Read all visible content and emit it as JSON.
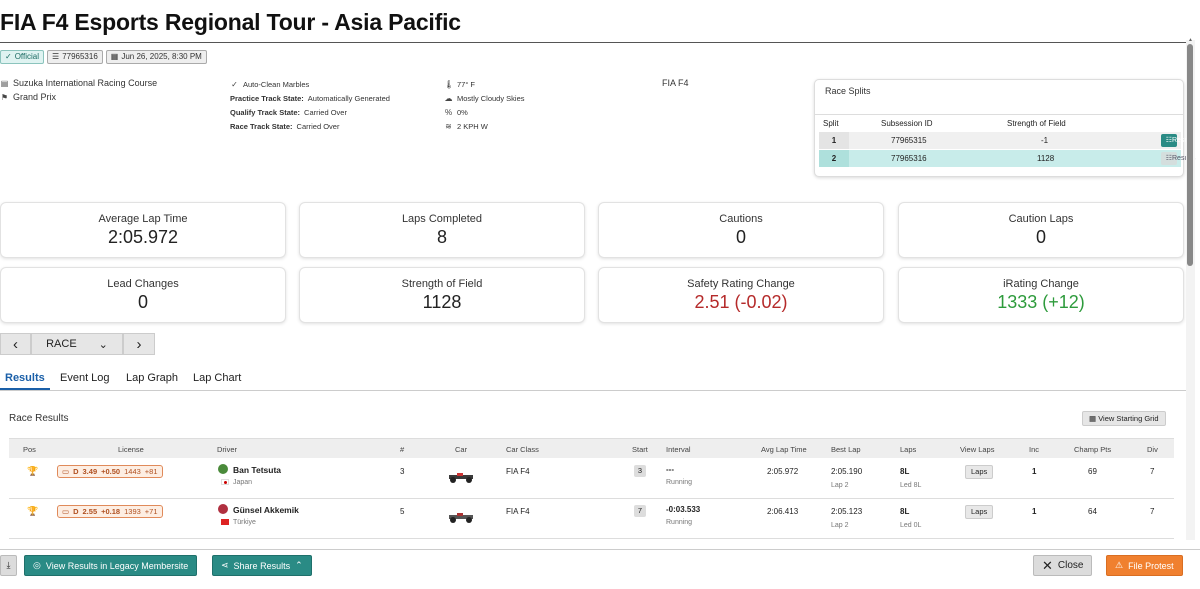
{
  "header": {
    "title": "FIA F4 Esports Regional Tour - Asia Pacific"
  },
  "badges": {
    "official": "Official",
    "subsession": "77965316",
    "date": "Jun 26, 2025, 8:30 PM"
  },
  "track": {
    "name": "Suzuka International Racing Course",
    "config": "Grand Prix"
  },
  "conditions": {
    "marbles": "Auto-Clean Marbles",
    "practice_label": "Practice Track State:",
    "practice_value": "Automatically Generated",
    "qualify_label": "Qualify Track State:",
    "qualify_value": "Carried Over",
    "race_label": "Race Track State:",
    "race_value": "Carried Over"
  },
  "weather": {
    "temp": "77° F",
    "sky": "Mostly Cloudy Skies",
    "rain": "0%",
    "wind": "2 KPH W"
  },
  "series_class": "FIA F4",
  "splits": {
    "title": "Race Splits",
    "headers": {
      "split": "Split",
      "subsession": "Subsession ID",
      "sof": "Strength of Field"
    },
    "rows": [
      {
        "split": "1",
        "subsession": "77965315",
        "sof": "-1",
        "button": "Results"
      },
      {
        "split": "2",
        "subsession": "77965316",
        "sof": "1128",
        "button": "Results"
      }
    ]
  },
  "stats": [
    {
      "label": "Average Lap Time",
      "value": "2:05.972"
    },
    {
      "label": "Laps Completed",
      "value": "8"
    },
    {
      "label": "Cautions",
      "value": "0"
    },
    {
      "label": "Caution Laps",
      "value": "0"
    },
    {
      "label": "Lead Changes",
      "value": "0"
    },
    {
      "label": "Strength of Field",
      "value": "1128"
    },
    {
      "label": "Safety Rating Change",
      "value": "2.51 (-0.02)"
    },
    {
      "label": "iRating Change",
      "value": "1333 (+12)"
    }
  ],
  "colors": {
    "accent": "#2a8b85",
    "negative": "#b52a2a",
    "positive": "#2e9b3c",
    "orange": "#f0802f",
    "tab_active": "#1a5fa8"
  },
  "session_nav": {
    "prev": "‹",
    "selected": "RACE",
    "next": "›"
  },
  "tabs": [
    "Results",
    "Event Log",
    "Lap Graph",
    "Lap Chart"
  ],
  "results": {
    "title": "Race Results",
    "view_grid": "View Starting Grid",
    "columns": [
      "Pos",
      "License",
      "Driver",
      "#",
      "Car",
      "Car Class",
      "Start",
      "Interval",
      "Avg Lap Time",
      "Best Lap",
      "Laps",
      "View Laps",
      "Inc",
      "Champ Pts",
      "Div"
    ],
    "rows": [
      {
        "license_class": "D",
        "sr": "3.49",
        "sr_change": "+0.50",
        "ir": "1443",
        "ir_change": "+81",
        "driver": "Ban Tetsuta",
        "country": "Japan",
        "num": "3",
        "car_class": "FIA F4",
        "start": "3",
        "interval": "---",
        "status": "Running",
        "avg": "2:05.972",
        "best": "2:05.190",
        "best_lap": "Lap 2",
        "laps": "8L",
        "led": "Led 8L",
        "laps_btn": "Laps",
        "inc": "1",
        "pts": "69",
        "div": "7"
      },
      {
        "license_class": "D",
        "sr": "2.55",
        "sr_change": "+0.18",
        "ir": "1393",
        "ir_change": "+71",
        "driver": "Günsel Akkemik",
        "country": "Türkiye",
        "num": "5",
        "car_class": "FIA F4",
        "start": "7",
        "interval": "-0:03.533",
        "status": "Running",
        "avg": "2:06.413",
        "best": "2:05.123",
        "best_lap": "Lap 2",
        "laps": "8L",
        "led": "Led 0L",
        "laps_btn": "Laps",
        "inc": "1",
        "pts": "64",
        "div": "7"
      }
    ]
  },
  "footer": {
    "legacy": "View Results in Legacy Membersite",
    "share": "Share Results",
    "close": "Close",
    "protest": "File Protest"
  }
}
